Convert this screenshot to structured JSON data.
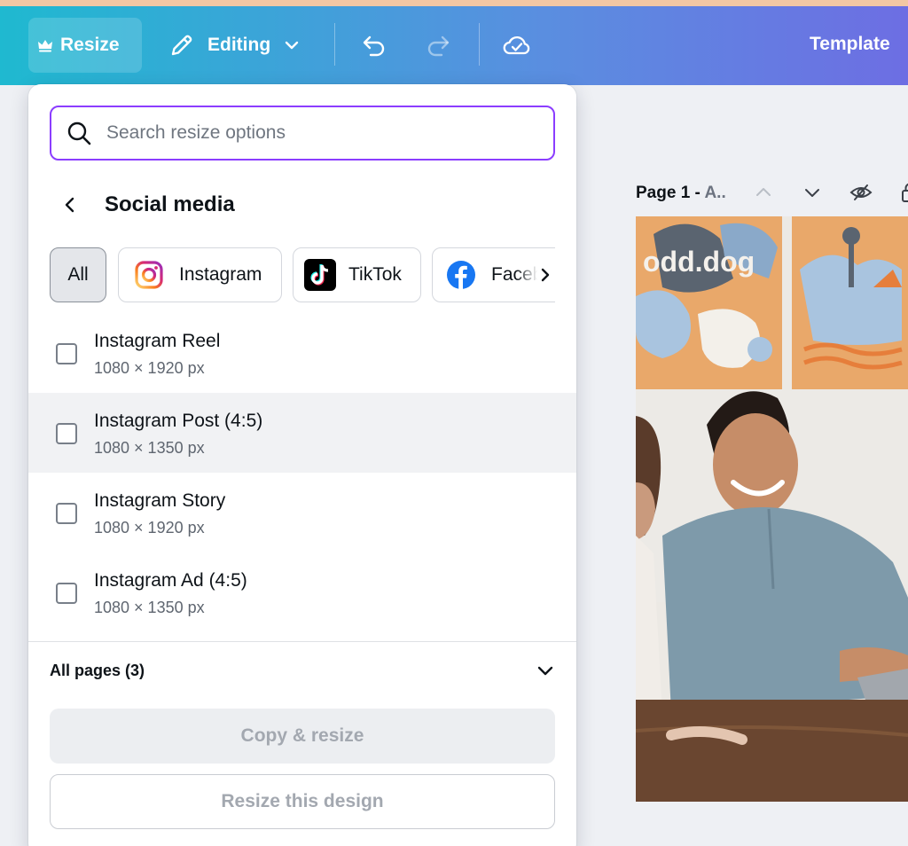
{
  "toolbar": {
    "resize_label": "Resize",
    "editing_label": "Editing",
    "template_label": "Template",
    "icons": [
      "crown-icon",
      "pencil-icon",
      "chevron-down-icon",
      "undo-icon",
      "redo-icon",
      "cloud-saved-icon"
    ]
  },
  "panel": {
    "search": {
      "placeholder": "Search resize options",
      "value": ""
    },
    "section_title": "Social media",
    "chips": [
      {
        "label": "All",
        "active": true
      },
      {
        "label": "Instagram",
        "icon": "instagram-logo-icon"
      },
      {
        "label": "TikTok",
        "icon": "tiktok-logo-icon"
      },
      {
        "label": "Facebo",
        "icon": "facebook-logo-icon"
      }
    ],
    "options": [
      {
        "name": "Instagram Reel",
        "size": "1080 × 1920 px",
        "checked": false
      },
      {
        "name": "Instagram Post (4:5)",
        "size": "1080 × 1350 px",
        "checked": false,
        "hovered": true
      },
      {
        "name": "Instagram Story",
        "size": "1080 × 1920 px",
        "checked": false
      },
      {
        "name": "Instagram Ad (4:5)",
        "size": "1080 × 1350 px",
        "checked": false
      }
    ],
    "pages_select": {
      "label": "All pages (3)"
    },
    "copy_resize_label": "Copy & resize",
    "resize_design_label": "Resize this design"
  },
  "canvas": {
    "page_label": "Page 1 - ",
    "page_title_truncated": "A..",
    "header_icons": [
      "chevron-up-icon",
      "chevron-down-icon",
      "hide-eye-icon",
      "lock-icon"
    ],
    "photo_sign_text": "odd.dog"
  },
  "colors": {
    "accent": "#8b3dff",
    "topbar_gradient_start": "#1fb9d0",
    "topbar_gradient_end": "#6d6ee3"
  }
}
